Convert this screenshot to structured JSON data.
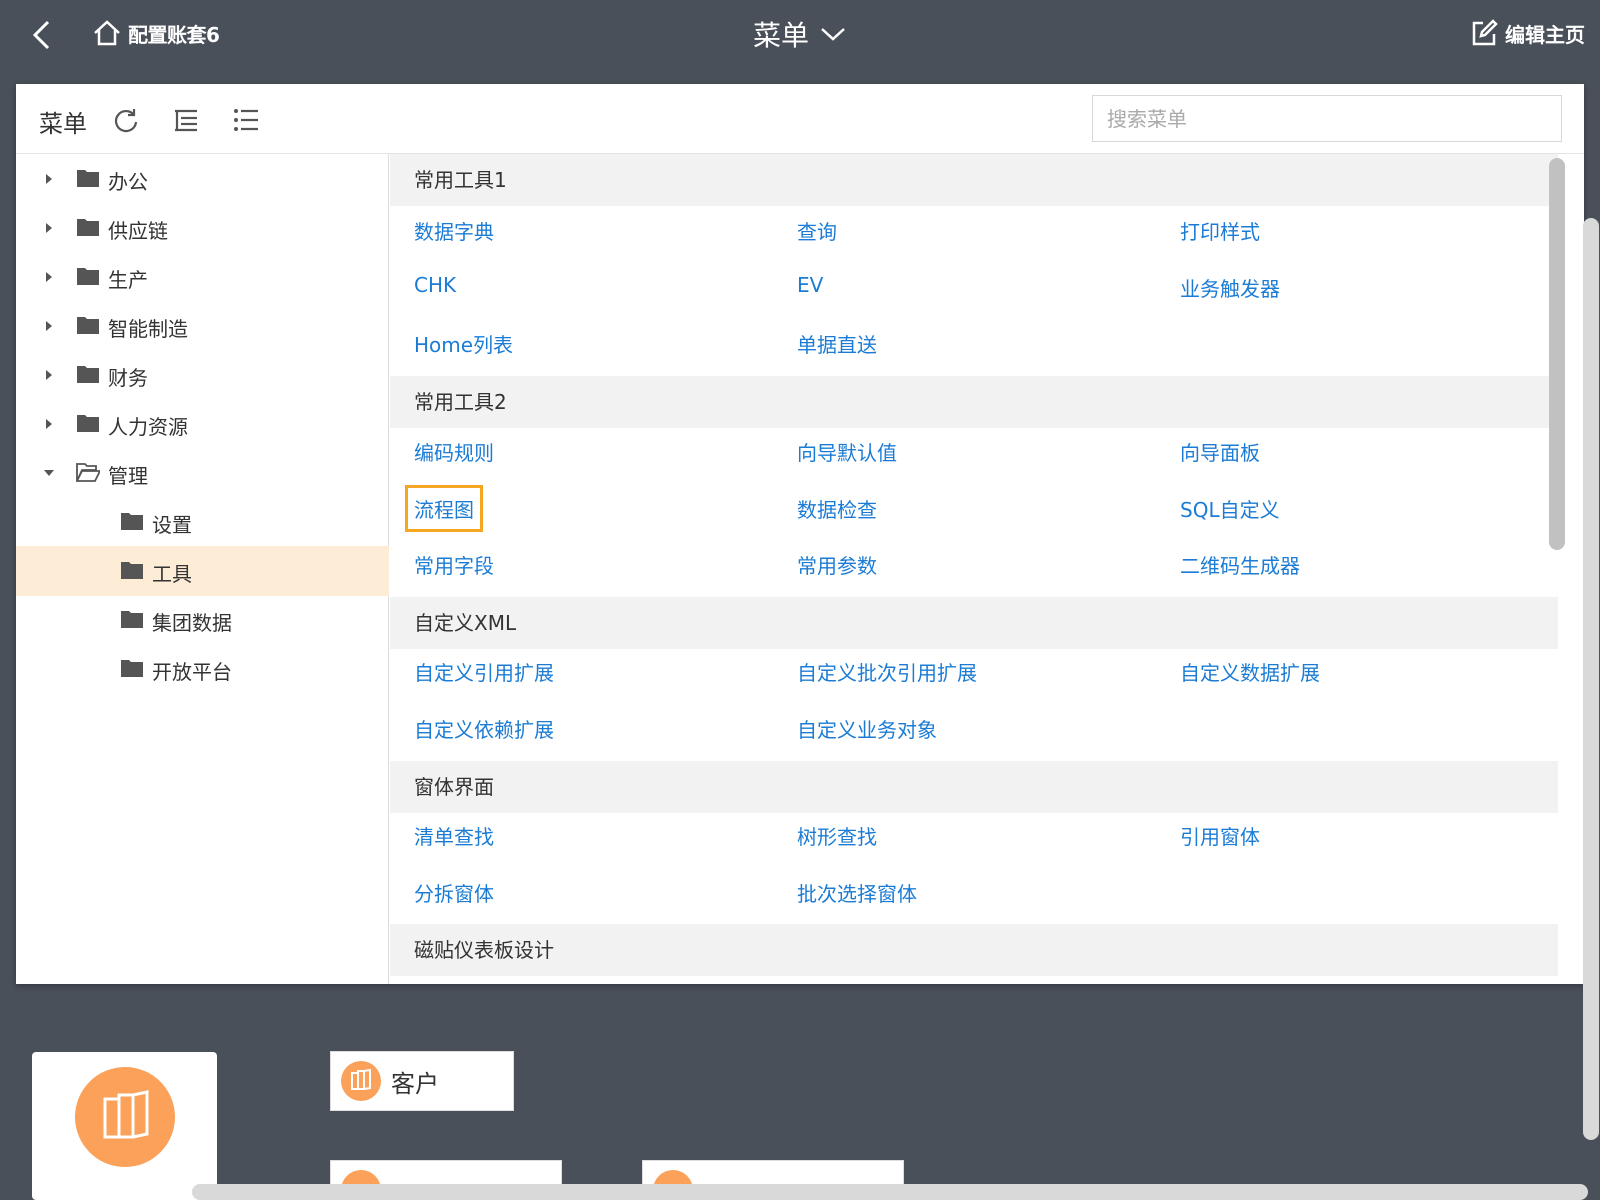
{
  "topbar": {
    "home_label": "配置账套6",
    "title": "菜单",
    "edit_label": "编辑主页"
  },
  "toolbar": {
    "label": "菜单",
    "search_placeholder": "搜索菜单"
  },
  "tree": [
    {
      "label": "办公",
      "expanded": false
    },
    {
      "label": "供应链",
      "expanded": false
    },
    {
      "label": "生产",
      "expanded": false
    },
    {
      "label": "智能制造",
      "expanded": false
    },
    {
      "label": "财务",
      "expanded": false
    },
    {
      "label": "人力资源",
      "expanded": false
    },
    {
      "label": "管理",
      "expanded": true
    },
    {
      "label": "设置"
    },
    {
      "label": "工具",
      "selected": true
    },
    {
      "label": "集团数据"
    },
    {
      "label": "开放平台"
    }
  ],
  "sections": [
    {
      "title": "常用工具1",
      "items": [
        "数据字典",
        "查询",
        "打印样式",
        "CHK",
        "EV",
        "业务触发器",
        "Home列表",
        "单据直送"
      ]
    },
    {
      "title": "常用工具2",
      "items": [
        "编码规则",
        "向导默认值",
        "向导面板",
        "流程图",
        "数据检查",
        "SQL自定义",
        "常用字段",
        "常用参数",
        "二维码生成器"
      ]
    },
    {
      "title": "自定义XML",
      "items": [
        "自定义引用扩展",
        "自定义批次引用扩展",
        "自定义数据扩展",
        "自定义依赖扩展",
        "自定义业务对象"
      ]
    },
    {
      "title": "窗体界面",
      "items": [
        "清单查找",
        "树形查找",
        "引用窗体",
        "分拆窗体",
        "批次选择窗体"
      ]
    },
    {
      "title": "磁贴仪表板设计",
      "items": []
    }
  ],
  "highlighted_item": "流程图",
  "tiles": {
    "customer_label": "客户"
  },
  "colors": {
    "background": "#4a5059",
    "link": "#1c7cd5",
    "selected_row": "#fdedd7",
    "highlight_border": "#f5a623",
    "tile_icon": "#fba15a"
  }
}
